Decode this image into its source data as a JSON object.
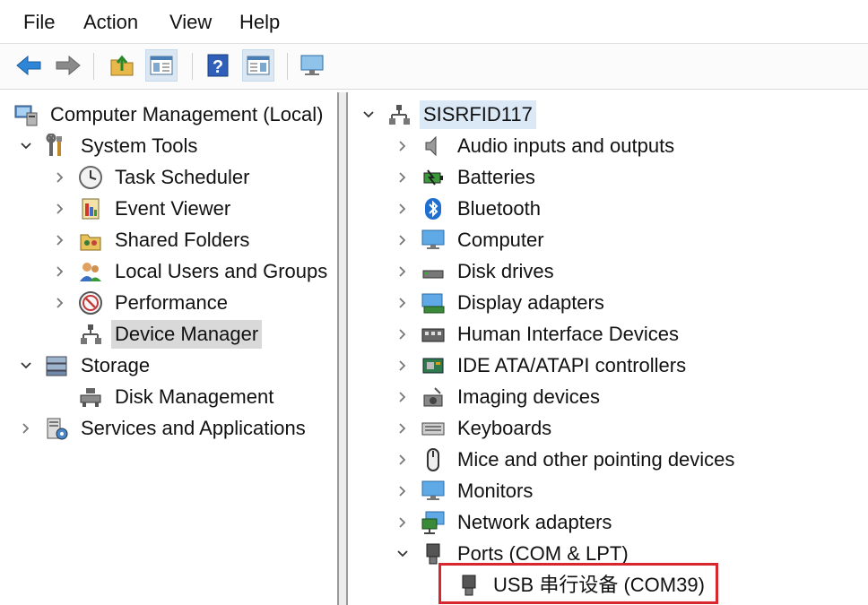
{
  "menu": [
    "File",
    "Action",
    "View",
    "Help"
  ],
  "toolbar": {
    "buttons": [
      "back-arrow-icon",
      "forward-arrow-icon",
      "up-folder-icon",
      "show-hide-tree-icon",
      "help-icon",
      "properties-pane-icon",
      "monitor-icon"
    ]
  },
  "tree": {
    "root": "Computer Management (Local)",
    "system_tools": "System Tools",
    "task_scheduler": "Task Scheduler",
    "event_viewer": "Event Viewer",
    "shared_folders": "Shared Folders",
    "local_users": "Local Users and Groups",
    "performance": "Performance",
    "device_manager": "Device Manager",
    "storage": "Storage",
    "disk_management": "Disk Management",
    "services": "Services and Applications"
  },
  "devices": {
    "root": "SISRFID117",
    "items": [
      "Audio inputs and outputs",
      "Batteries",
      "Bluetooth",
      "Computer",
      "Disk drives",
      "Display adapters",
      "Human Interface Devices",
      "IDE ATA/ATAPI controllers",
      "Imaging devices",
      "Keyboards",
      "Mice and other pointing devices",
      "Monitors",
      "Network adapters",
      "Ports (COM & LPT)"
    ],
    "port_child": "USB 串行设备 (COM39)"
  },
  "colors": {
    "highlight_border": "#d8262e",
    "selected_bg": "#d9d9d9",
    "root_bg": "#dbe9f6"
  }
}
